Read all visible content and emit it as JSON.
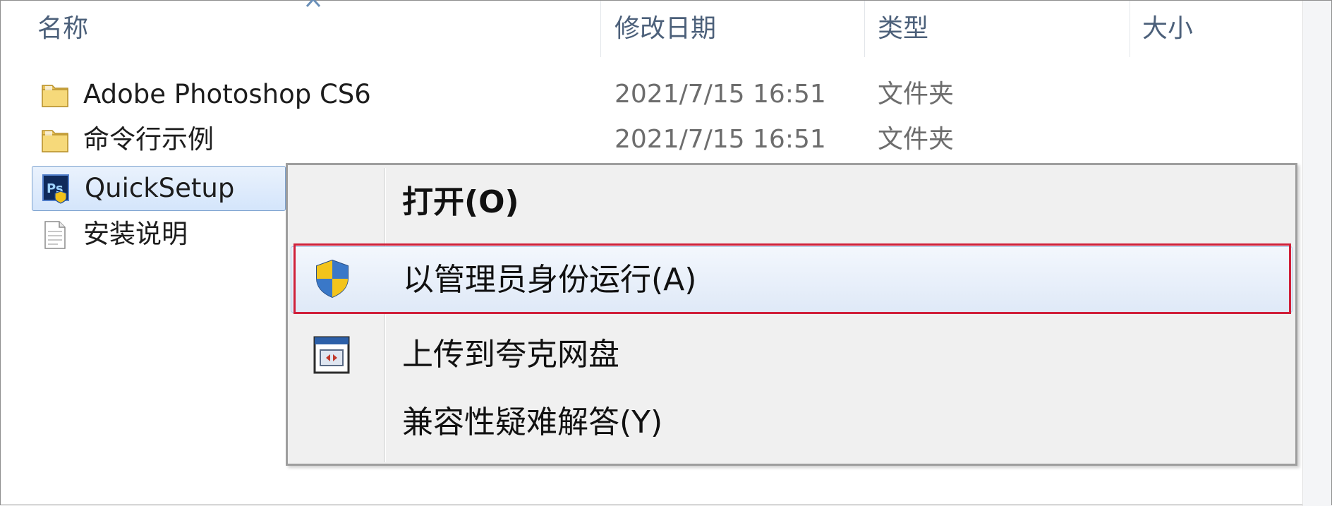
{
  "columns": {
    "name": "名称",
    "modified": "修改日期",
    "type": "类型",
    "size": "大小"
  },
  "files": [
    {
      "name": "Adobe Photoshop CS6",
      "modified": "2021/7/15 16:51",
      "type": "文件夹",
      "icon": "folder-icon"
    },
    {
      "name": "命令行示例",
      "modified": "2021/7/15 16:51",
      "type": "文件夹",
      "icon": "folder-icon"
    },
    {
      "name": "QuickSetup",
      "modified": "",
      "type": "",
      "icon": "photoshop-app-icon",
      "selected": true
    },
    {
      "name": "安装说明",
      "modified": "",
      "type": "",
      "icon": "text-document-icon"
    }
  ],
  "context_menu": {
    "items": [
      {
        "label": "打开(O)",
        "bold": true,
        "icon": ""
      },
      {
        "label": "以管理员身份运行(A)",
        "icon": "uac-shield-icon",
        "hovered": true
      },
      {
        "label": "上传到夸克网盘",
        "icon": "upload-app-icon"
      },
      {
        "label": "兼容性疑难解答(Y)",
        "icon": ""
      }
    ]
  },
  "colors": {
    "highlight_border": "#d0203a",
    "selection": "#d4e5fb",
    "menu_background": "#f0f0f0"
  }
}
